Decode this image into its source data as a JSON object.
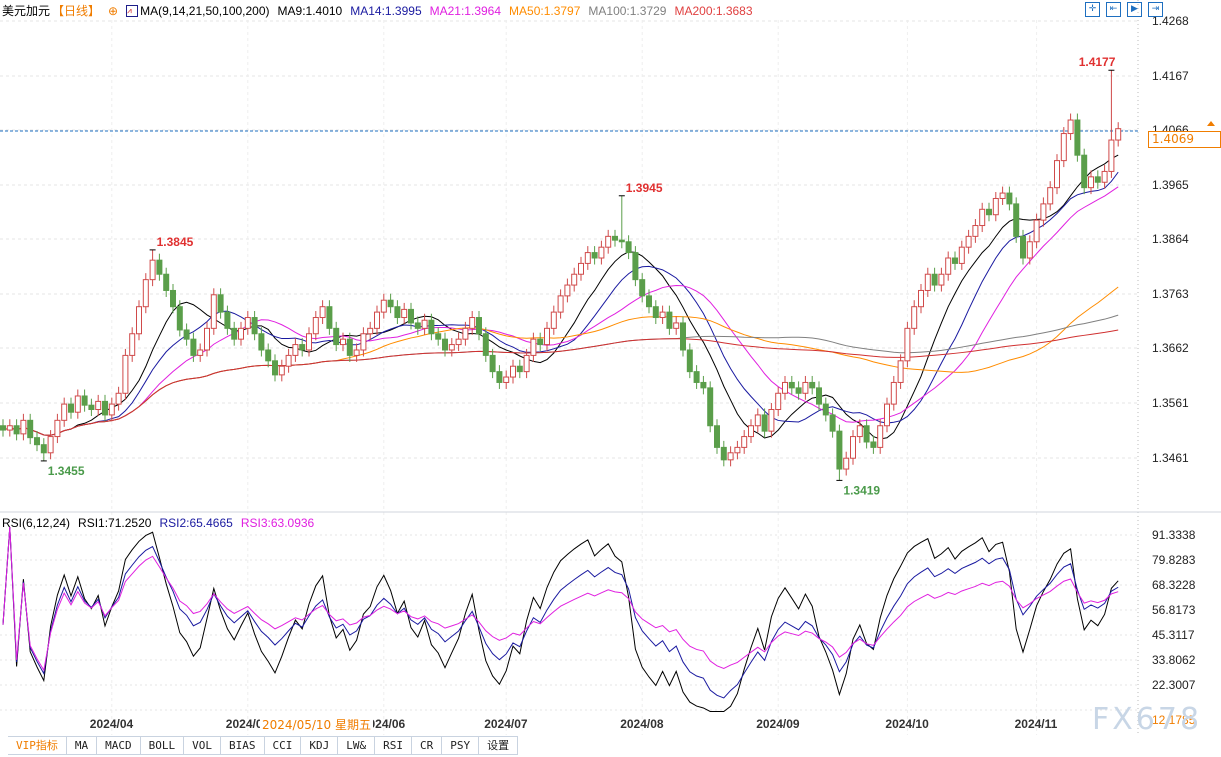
{
  "header": {
    "symbol": "美元加元",
    "period": "【日线】",
    "ma_label": "MA(9,14,21,50,100,200)",
    "ma9": "MA9:1.4010",
    "ma14": "MA14:1.3995",
    "ma21": "MA21:1.3964",
    "ma50": "MA50:1.3797",
    "ma100": "MA100:1.3729",
    "ma200": "MA200:1.3683"
  },
  "rsi_header": {
    "label": "RSI(6,12,24)",
    "rsi1": "RSI1:71.2520",
    "rsi2": "RSI2:65.4665",
    "rsi3": "RSI3:63.0936"
  },
  "colors": {
    "up": "#d04a4a",
    "down": "#5a9e4a",
    "ma9": "#000000",
    "ma14": "#1a1aa0",
    "ma21": "#e020e0",
    "ma50": "#ff8c00",
    "ma100": "#808080",
    "ma200": "#d03030",
    "current": "#1e6fc0",
    "accent": "#f07d00"
  },
  "price_axis": [
    "1.4268",
    "1.4167",
    "1.4066",
    "1.3965",
    "1.3864",
    "1.3763",
    "1.3662",
    "1.3561",
    "1.3461"
  ],
  "rsi_axis": [
    "91.3338",
    "79.8283",
    "68.3228",
    "56.8173",
    "45.3117",
    "33.8062",
    "22.3007",
    "12.1785"
  ],
  "current_price": "1.4069",
  "date_axis": [
    "2024/04",
    "2024/05",
    "2024/06",
    "2024/07",
    "2024/08",
    "2024/09",
    "2024/10",
    "2024/11"
  ],
  "date_axis_index": [
    16,
    36,
    56,
    74,
    94,
    114,
    133,
    152
  ],
  "tooltip_date": "2024/05/10 星期五",
  "annotations": [
    {
      "label": "1.3845",
      "index": 22,
      "value": 1.3845,
      "type": "high"
    },
    {
      "label": "1.3455",
      "index": 6,
      "value": 1.3455,
      "type": "low"
    },
    {
      "label": "1.3945",
      "index": 91,
      "value": 1.3945,
      "type": "high"
    },
    {
      "label": "1.3419",
      "index": 123,
      "value": 1.3419,
      "type": "low"
    },
    {
      "label": "1.4177",
      "index": 163,
      "value": 1.4177,
      "type": "high"
    }
  ],
  "closes": [
    1.3512,
    1.352,
    1.3505,
    1.353,
    1.3498,
    1.3485,
    1.347,
    1.35,
    1.353,
    1.356,
    1.3545,
    1.3575,
    1.3558,
    1.355,
    1.3565,
    1.354,
    1.356,
    1.358,
    1.365,
    1.369,
    1.374,
    1.379,
    1.3826,
    1.38,
    1.377,
    1.374,
    1.3697,
    1.368,
    1.365,
    1.366,
    1.37,
    1.3762,
    1.373,
    1.37,
    1.368,
    1.37,
    1.372,
    1.369,
    1.366,
    1.364,
    1.3614,
    1.363,
    1.365,
    1.367,
    1.366,
    1.369,
    1.372,
    1.374,
    1.37,
    1.367,
    1.368,
    1.365,
    1.366,
    1.369,
    1.37,
    1.373,
    1.3752,
    1.374,
    1.372,
    1.3735,
    1.371,
    1.37,
    1.3715,
    1.369,
    1.368,
    1.366,
    1.367,
    1.368,
    1.37,
    1.372,
    1.369,
    1.365,
    1.362,
    1.36,
    1.361,
    1.363,
    1.362,
    1.365,
    1.368,
    1.367,
    1.37,
    1.373,
    1.376,
    1.378,
    1.38,
    1.382,
    1.384,
    1.383,
    1.385,
    1.387,
    1.3863,
    1.386,
    1.384,
    1.379,
    1.376,
    1.374,
    1.372,
    1.373,
    1.37,
    1.371,
    1.366,
    1.362,
    1.36,
    1.359,
    1.352,
    1.348,
    1.3457,
    1.347,
    1.348,
    1.35,
    1.352,
    1.354,
    1.351,
    1.355,
    1.358,
    1.36,
    1.359,
    1.358,
    1.36,
    1.359,
    1.356,
    1.354,
    1.351,
    1.344,
    1.346,
    1.35,
    1.352,
    1.349,
    1.348,
    1.352,
    1.356,
    1.36,
    1.364,
    1.37,
    1.374,
    1.377,
    1.38,
    1.378,
    1.38,
    1.383,
    1.382,
    1.385,
    1.387,
    1.389,
    1.392,
    1.391,
    1.394,
    1.395,
    1.393,
    1.387,
    1.383,
    1.386,
    1.39,
    1.393,
    1.396,
    1.401,
    1.406,
    1.4085,
    1.402,
    1.396,
    1.398,
    1.397,
    1.399,
    1.4048,
    1.4069
  ],
  "toolbar": {
    "tabs": [
      "VIP指标",
      "MA",
      "MACD",
      "BOLL",
      "VOL",
      "BIAS",
      "CCI",
      "KDJ",
      "LW&",
      "RSI",
      "CR",
      "PSY",
      "设置"
    ]
  },
  "watermark": "FX678"
}
